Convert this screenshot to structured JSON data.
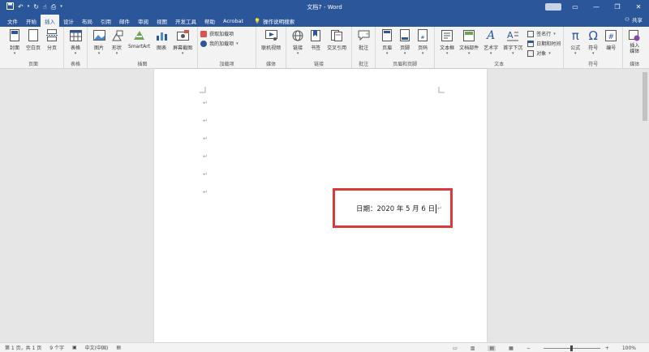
{
  "titlebar": {
    "title": "文档7 - Word",
    "qat_icons": [
      "save-icon",
      "undo-icon",
      "redo-icon",
      "touch-mode-icon",
      "print-preview-icon",
      "customize-qat-icon"
    ]
  },
  "window": {
    "minimize": "—",
    "restore": "❐",
    "close": "✕"
  },
  "tabs": [
    "文件",
    "开始",
    "插入",
    "设计",
    "布局",
    "引用",
    "邮件",
    "审阅",
    "视图",
    "开发工具",
    "帮助",
    "Acrobat"
  ],
  "active_tab": "插入",
  "tell_me": "操作说明搜索",
  "share": "共享",
  "ribbon": {
    "pages": {
      "label": "页面",
      "cover": "封面",
      "blank": "空白页",
      "break": "分页"
    },
    "tables": {
      "label": "表格",
      "table": "表格"
    },
    "illustrations": {
      "label": "插图",
      "picture": "图片",
      "shapes": "形状",
      "smartart": "SmartArt",
      "chart": "图表",
      "screenshot": "屏幕截图"
    },
    "addins": {
      "label": "加载项",
      "get": "获取加载项",
      "my": "我的加载项"
    },
    "media": {
      "label": "媒体",
      "online_video": "联机视频"
    },
    "links": {
      "label": "链接",
      "link": "链接",
      "bookmark": "书签",
      "crossref": "交叉引用"
    },
    "comments": {
      "label": "批注",
      "comment": "批注"
    },
    "header_footer": {
      "label": "页眉和页脚",
      "header": "页眉",
      "footer": "页脚",
      "page_number": "页码"
    },
    "text": {
      "label": "文本",
      "textbox": "文本框",
      "quickparts": "文档部件",
      "wordart": "艺术字",
      "dropcap": "首字下沉",
      "signature": "签名行",
      "datetime": "日期和时间",
      "object": "对象"
    },
    "symbols": {
      "label": "符号",
      "equation": "公式",
      "symbol": "符号",
      "number": "编号"
    },
    "media2": {
      "label": "媒体",
      "insert_media": "插入\n媒体"
    }
  },
  "document": {
    "para_mark": "↵",
    "date_text": "日期：2020 年 5 月 6 日"
  },
  "status": {
    "page": "第 1 页，共 1 页",
    "words": "9 个字",
    "lang": "中文(中国)",
    "zoom": "100%",
    "zoom_level": 0.5
  },
  "colors": {
    "accent": "#2b579a",
    "highlight": "#d93a3a"
  }
}
